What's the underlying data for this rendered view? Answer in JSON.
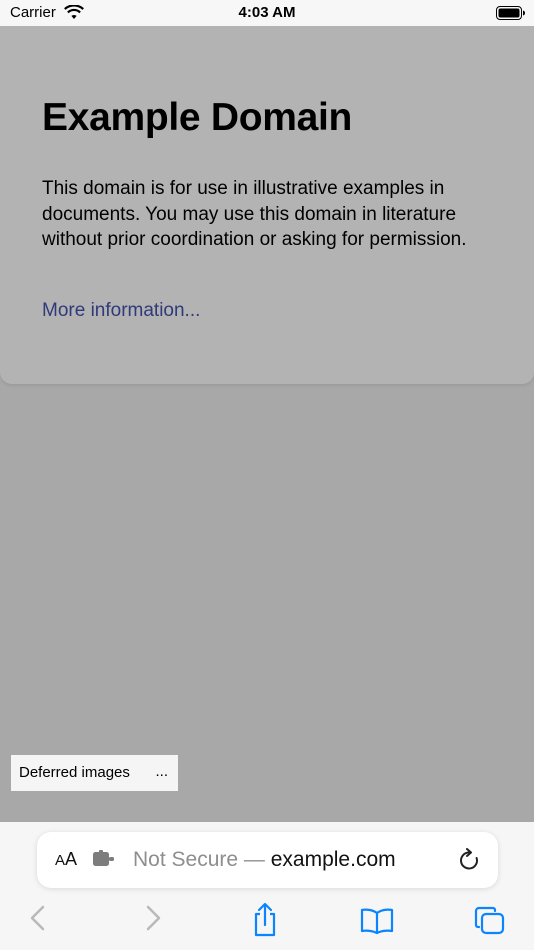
{
  "status_bar": {
    "carrier": "Carrier",
    "time": "4:03 AM"
  },
  "page": {
    "heading": "Example Domain",
    "paragraph": "This domain is for use in illustrative examples in documents. You may use this domain in literature without prior coordination or asking for permission.",
    "link": "More information..."
  },
  "deferred_images": {
    "label": "Deferred images",
    "more": "..."
  },
  "address_bar": {
    "aa_small": "A",
    "aa_large": "A",
    "security": "Not Secure —",
    "host": "example.com"
  },
  "toolbar": {
    "icons": [
      "back-icon",
      "forward-icon",
      "share-icon",
      "bookmarks-icon",
      "tabs-icon"
    ],
    "accent": "#0a84ff",
    "disabled": "#b9b9b9"
  }
}
